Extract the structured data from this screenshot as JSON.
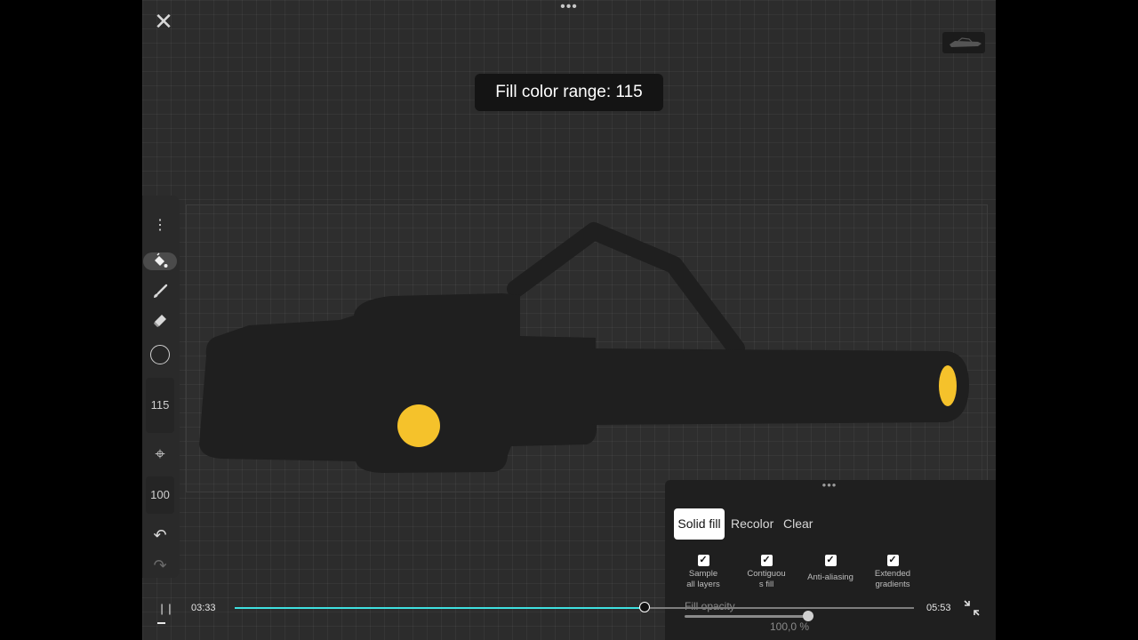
{
  "toast": {
    "text": "Fill color range: 115"
  },
  "toolbar": {
    "more": "⋮",
    "fill_range_value": "115",
    "target": "⌖",
    "opacity_value": "100",
    "undo": "↶",
    "redo": "↷"
  },
  "fill_panel": {
    "tabs": [
      {
        "label": "Solid fill",
        "selected": true
      },
      {
        "label": "Recolor",
        "selected": false
      },
      {
        "label": "Clear",
        "selected": false
      }
    ],
    "options": [
      {
        "label": "Sample\nall layers",
        "checked": true
      },
      {
        "label": "Contiguou\ns fill",
        "checked": true
      },
      {
        "label": "Anti-aliasing",
        "checked": true
      },
      {
        "label": "Extended\ngradients",
        "checked": true
      }
    ],
    "opacity": {
      "label": "Fill opacity",
      "value_text": "100,0 %",
      "value": 1.0
    }
  },
  "video": {
    "current_time": "03:33",
    "total_time": "05:53",
    "progress": 0.603
  },
  "icons": {
    "close": "close-icon",
    "paint_bucket": "paint-bucket-icon",
    "brush": "brush-icon",
    "eraser": "eraser-icon",
    "fullscreen_exit": "exit-fullscreen-icon"
  },
  "colors": {
    "accent": "#3ee0e0",
    "shape_fill": "#1f1f1f",
    "yellow": "#f5c22b"
  }
}
